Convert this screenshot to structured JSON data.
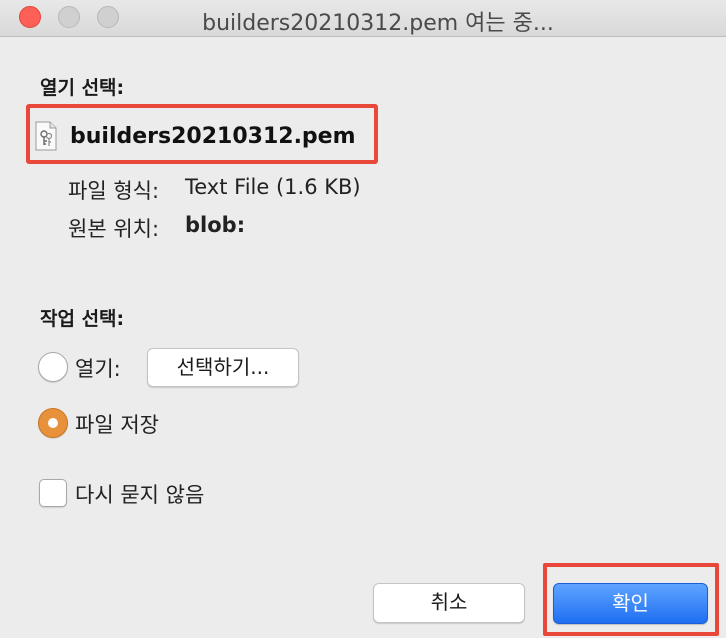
{
  "window": {
    "title": "builders20210312.pem 여는 중..."
  },
  "open_section": {
    "label": "열기 선택:",
    "file_name": "builders20210312.pem",
    "file_icon": "document-key-icon",
    "type_key": "파일 형식:",
    "type_value": "Text File (1.6 KB)",
    "source_key": "원본 위치:",
    "source_value": "blob:"
  },
  "action_section": {
    "label": "작업 선택:",
    "open_with_label": "열기:",
    "choose_button": "선택하기...",
    "save_file_label": "파일 저장",
    "selected_option": "save_file",
    "dont_ask_label": "다시 묻지 않음",
    "dont_ask_checked": false
  },
  "footer": {
    "cancel_label": "취소",
    "ok_label": "확인"
  },
  "colors": {
    "accent": "#1f6ff2",
    "radio_selected": "#e7923a",
    "highlight_box": "#e8473a"
  }
}
